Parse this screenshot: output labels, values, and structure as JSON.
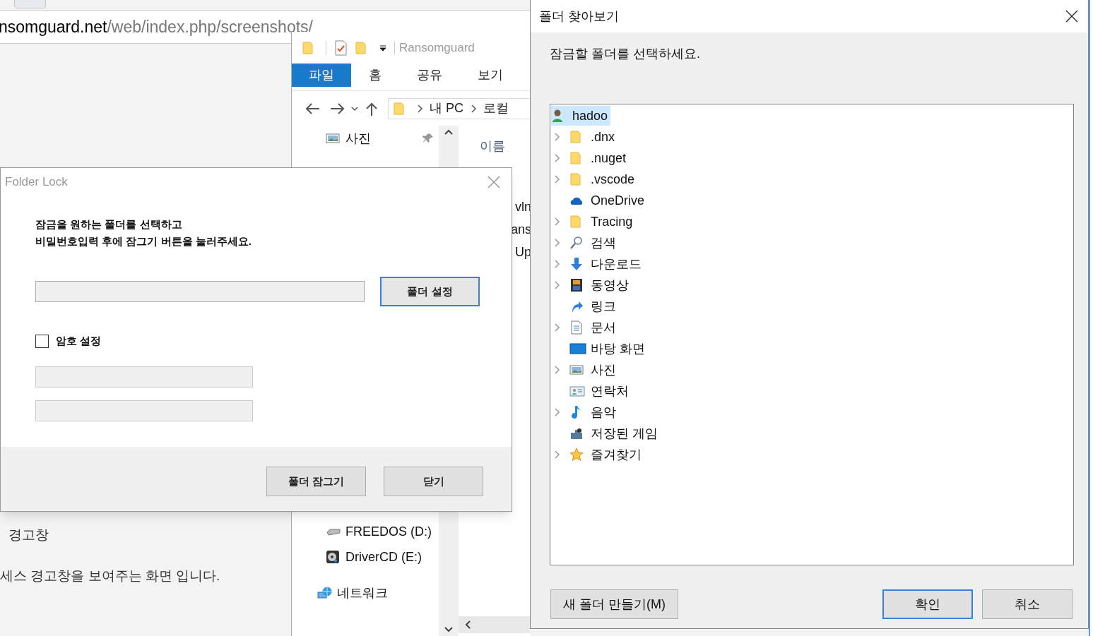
{
  "browser": {
    "url_host": "nsomguard.net",
    "url_path": "/web/index.php/screenshots/",
    "heading": "경고창",
    "paragraph": "세스 경고창을 보여주는 화면 입니다."
  },
  "explorer": {
    "title": "Ransomguard",
    "tabs": [
      {
        "label": "파일",
        "selected": true
      },
      {
        "label": "홈",
        "selected": false
      },
      {
        "label": "공유",
        "selected": false
      },
      {
        "label": "보기",
        "selected": false
      }
    ],
    "breadcrumb": [
      "내 PC",
      "로컬"
    ],
    "nav_top": [
      {
        "label": "사진",
        "kind": "pictures",
        "pinned": true
      }
    ],
    "nav_bottom": [
      {
        "label": "FREEDOS (D:)",
        "kind": "drive",
        "pinned": false
      },
      {
        "label": "DriverCD (E:)",
        "kind": "cd",
        "pinned": false
      },
      {
        "label": "네트워크",
        "kind": "network",
        "pinned": false
      }
    ],
    "column_header": "이름",
    "file_fragments": [
      "vln",
      "ans",
      "Up"
    ]
  },
  "folder_lock": {
    "title": "Folder Lock",
    "instruction": [
      "잠금을 원하는 폴더를 선택하고",
      "비밀번호입력 후에 잠그기 버튼을 눌러주세요."
    ],
    "folder_button": "폴더 설정",
    "password_checkbox": {
      "label": "암호 설정",
      "checked": false
    },
    "buttons": [
      "폴더 잠그기",
      "닫기"
    ]
  },
  "browse_dialog": {
    "title": "폴더 찾아보기",
    "prompt": "잠금할 폴더를 선택하세요.",
    "tree": {
      "label": "hadoo",
      "kind": "user",
      "selected": true,
      "children": [
        {
          "label": ".dnx",
          "kind": "folder",
          "expandable": true,
          "selected": false
        },
        {
          "label": ".nuget",
          "kind": "folder",
          "expandable": true,
          "selected": false
        },
        {
          "label": ".vscode",
          "kind": "folder",
          "expandable": true,
          "selected": false
        },
        {
          "label": "OneDrive",
          "kind": "cloud",
          "expandable": false,
          "selected": false
        },
        {
          "label": "Tracing",
          "kind": "folder",
          "expandable": true,
          "selected": false
        },
        {
          "label": "검색",
          "kind": "search",
          "expandable": true,
          "selected": false
        },
        {
          "label": "다운로드",
          "kind": "download",
          "expandable": true,
          "selected": false
        },
        {
          "label": "동영상",
          "kind": "film",
          "expandable": true,
          "selected": false
        },
        {
          "label": "링크",
          "kind": "link",
          "expandable": false,
          "selected": false
        },
        {
          "label": "문서",
          "kind": "document",
          "expandable": true,
          "selected": false
        },
        {
          "label": "바탕 화면",
          "kind": "desktop",
          "expandable": false,
          "selected": false
        },
        {
          "label": "사진",
          "kind": "pictures",
          "expandable": true,
          "selected": false
        },
        {
          "label": "연락처",
          "kind": "contacts",
          "expandable": false,
          "selected": false
        },
        {
          "label": "음악",
          "kind": "music",
          "expandable": true,
          "selected": false
        },
        {
          "label": "저장된 게임",
          "kind": "games",
          "expandable": false,
          "selected": false
        },
        {
          "label": "즐겨찾기",
          "kind": "star",
          "expandable": true,
          "selected": false
        }
      ]
    },
    "buttons": [
      {
        "label": "새 폴더 만들기(M)",
        "kind": "secondary"
      },
      {
        "label": "확인",
        "kind": "default"
      },
      {
        "label": "취소",
        "kind": "normal"
      }
    ]
  }
}
